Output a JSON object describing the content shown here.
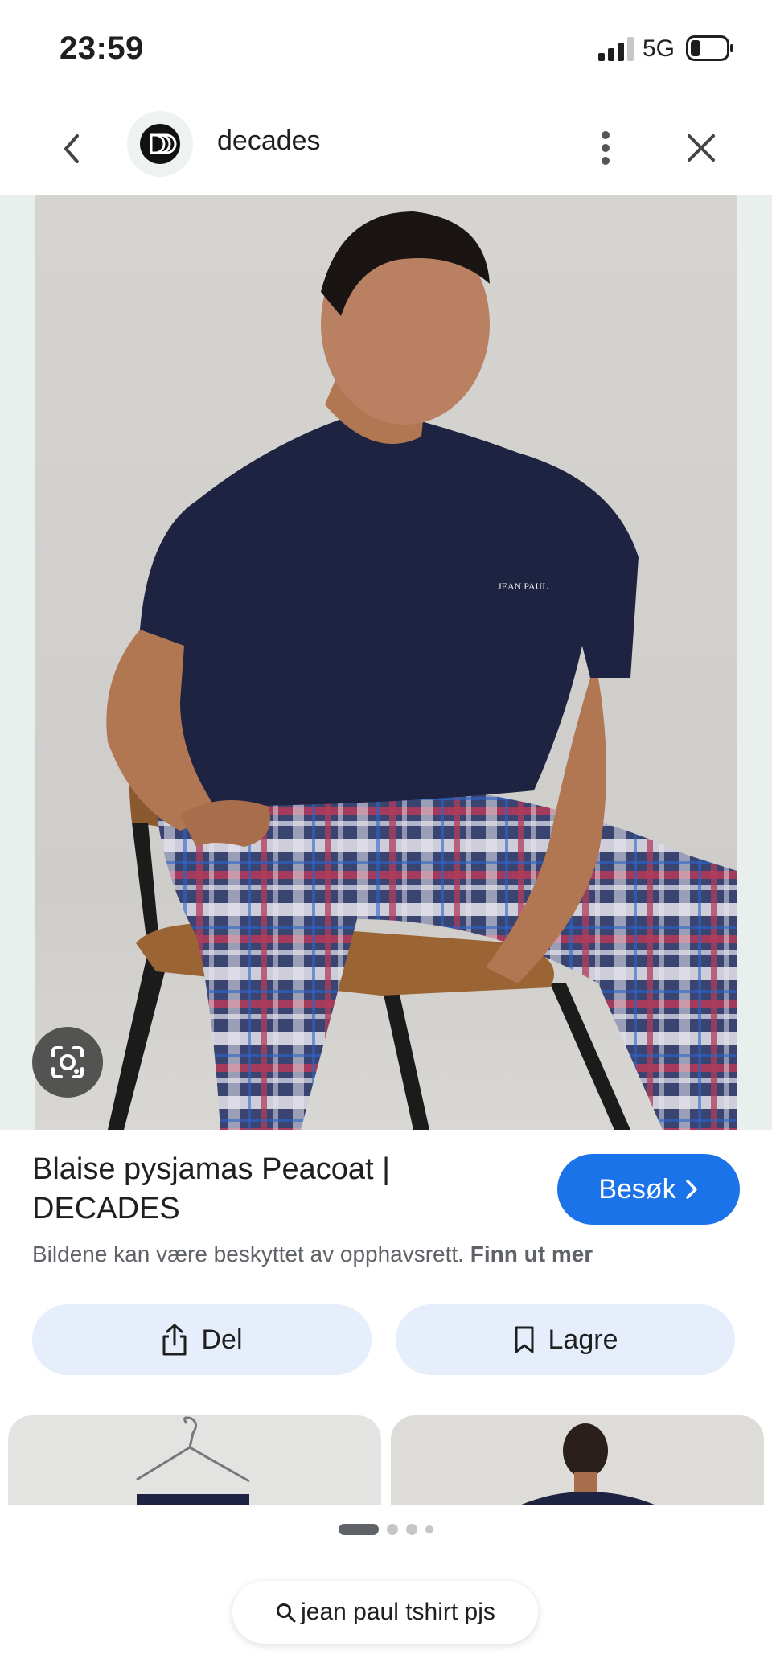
{
  "status_bar": {
    "time": "23:59",
    "network": "5G"
  },
  "nav": {
    "site_name": "decades",
    "back_icon": "chevron-left-icon",
    "more_icon": "more-vertical-icon",
    "close_icon": "close-icon"
  },
  "image": {
    "shirt_logo": "JEAN PAUL"
  },
  "result": {
    "title": "Blaise pysjamas Peacoat | DECADES",
    "visit_label": "Besøk",
    "copyright_text": "Bildene kan være beskyttet av opphavsrett.",
    "copyright_link": "Finn ut mer"
  },
  "actions": {
    "share_label": "Del",
    "save_label": "Lagre"
  },
  "search": {
    "query": "jean paul tshirt pjs"
  },
  "colors": {
    "accent": "#1a73e8",
    "action_bg": "#e6edfb",
    "shirt": "#1d2340"
  }
}
